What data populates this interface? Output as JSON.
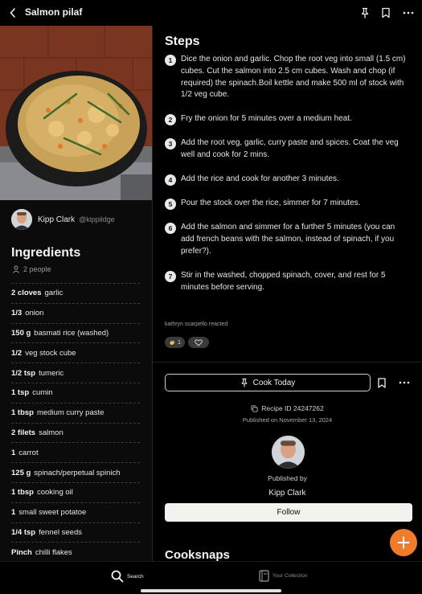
{
  "header": {
    "title": "Salmon pilaf"
  },
  "author": {
    "name": "Kipp Clark",
    "handle": "@kippildge"
  },
  "ingredients": {
    "heading": "Ingredients",
    "servings": "2 people",
    "items": [
      {
        "qty": "2 cloves",
        "name": "garlic"
      },
      {
        "qty": "1/3",
        "name": "onion"
      },
      {
        "qty": "150 g",
        "name": "basmati rice (washed)"
      },
      {
        "qty": "1/2",
        "name": "veg stock cube"
      },
      {
        "qty": "1/2 tsp",
        "name": "tumeric"
      },
      {
        "qty": "1 tsp",
        "name": "cumin"
      },
      {
        "qty": "1 tbsp",
        "name": "medium curry paste"
      },
      {
        "qty": "2 filets",
        "name": "salmon"
      },
      {
        "qty": "1",
        "name": "carrot"
      },
      {
        "qty": "125 g",
        "name": "spinach/perpetual spinich"
      },
      {
        "qty": "1 tbsp",
        "name": "cooking oil"
      },
      {
        "qty": "1",
        "name": "small sweet potatoe"
      },
      {
        "qty": "1/4 tsp",
        "name": "fennel seeds"
      },
      {
        "qty": "Pinch",
        "name": "chilli flakes"
      }
    ]
  },
  "steps": {
    "heading": "Steps",
    "items": [
      {
        "num": "1",
        "text": "Dice the onion and garlic. Chop the root veg into small (1.5 cm) cubes. Cut the salmon into 2.5 cm cubes. Wash and chop (if required) the spinach.Boil kettle and make 500 ml of stock with 1/2 veg cube."
      },
      {
        "num": "2",
        "text": "Fry the onion for 5 minutes over a medium heat."
      },
      {
        "num": "3",
        "text": "Add the root veg, garlic, curry paste and spices. Coat the veg well and cook for 2 mins."
      },
      {
        "num": "4",
        "text": "Add the rice and cook for another 3 minutes."
      },
      {
        "num": "5",
        "text": "Pour the stock over the rice, simmer for 7 minutes."
      },
      {
        "num": "6",
        "text": "Add the salmon and simmer for a further 5 minutes (you can add french beans with the salmon, instead of spinach, if you prefer?)."
      },
      {
        "num": "7",
        "text": "Stir in the washed, chopped spinach, cover, and rest for 5 minutes before serving."
      }
    ]
  },
  "reactions": {
    "text": "kathryn scarpello reacted",
    "clap_count": "1"
  },
  "actions": {
    "cook_today": "Cook Today",
    "recipe_id": "Recipe ID 24247262",
    "published_on": "Published on November 13, 2024",
    "published_by": "Published by",
    "publisher_name": "Kipp Clark",
    "follow": "Follow"
  },
  "cooksnaps": {
    "heading": "Cooksnaps"
  },
  "bottom_nav": {
    "search": "Search",
    "collection": "Your Collection"
  },
  "colors": {
    "accent": "#f07b2a",
    "background": "#000000"
  }
}
